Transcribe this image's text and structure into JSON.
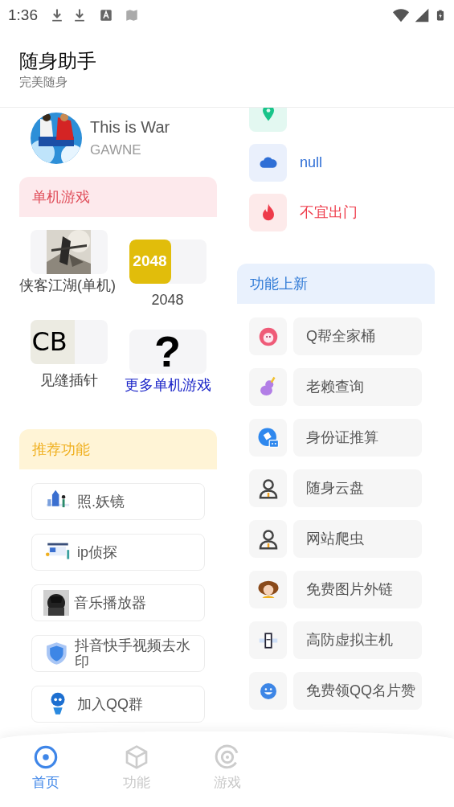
{
  "status_bar": {
    "time": "1:36"
  },
  "app_bar": {
    "title": "随身助手",
    "subtitle": "完美随身"
  },
  "now_playing": {
    "title": "This is War",
    "artist": "GAWNE"
  },
  "weather": [
    {
      "kind": "location",
      "color": "#19c48a"
    },
    {
      "kind": "cloud",
      "color": "#2f6fd6",
      "text": "null"
    },
    {
      "kind": "fire",
      "color": "#ee3b4a",
      "text": "不宜出门"
    }
  ],
  "games_section": {
    "title": "单机游戏",
    "games": [
      {
        "kind": "picture",
        "label": "侠客江湖(单机)"
      },
      {
        "kind": "tile",
        "badge": "2048",
        "label": "2048"
      },
      {
        "kind": "letters",
        "badge": "CB",
        "label": "见缝插针"
      },
      {
        "kind": "link",
        "badge": "?",
        "label": "更多单机游戏"
      }
    ]
  },
  "recommend_section": {
    "title": "推荐功能",
    "items": [
      {
        "label": "照.妖镜"
      },
      {
        "label": "ip侦探"
      },
      {
        "label": "音乐播放器"
      },
      {
        "label": "抖音快手视频去水印"
      },
      {
        "label": "加入QQ群"
      }
    ]
  },
  "new_section": {
    "title": "功能上新",
    "items": [
      {
        "label": "Q帮全家桶"
      },
      {
        "label": "老赖查询"
      },
      {
        "label": "身份证推算"
      },
      {
        "label": "随身云盘"
      },
      {
        "label": "网站爬虫"
      },
      {
        "label": "免费图片外链"
      },
      {
        "label": "高防虚拟主机"
      },
      {
        "label": "免费领QQ名片赞"
      }
    ]
  },
  "tabs": [
    {
      "label": "首页",
      "selected": true
    },
    {
      "label": "功能",
      "selected": false
    },
    {
      "label": "游戏",
      "selected": false
    }
  ]
}
